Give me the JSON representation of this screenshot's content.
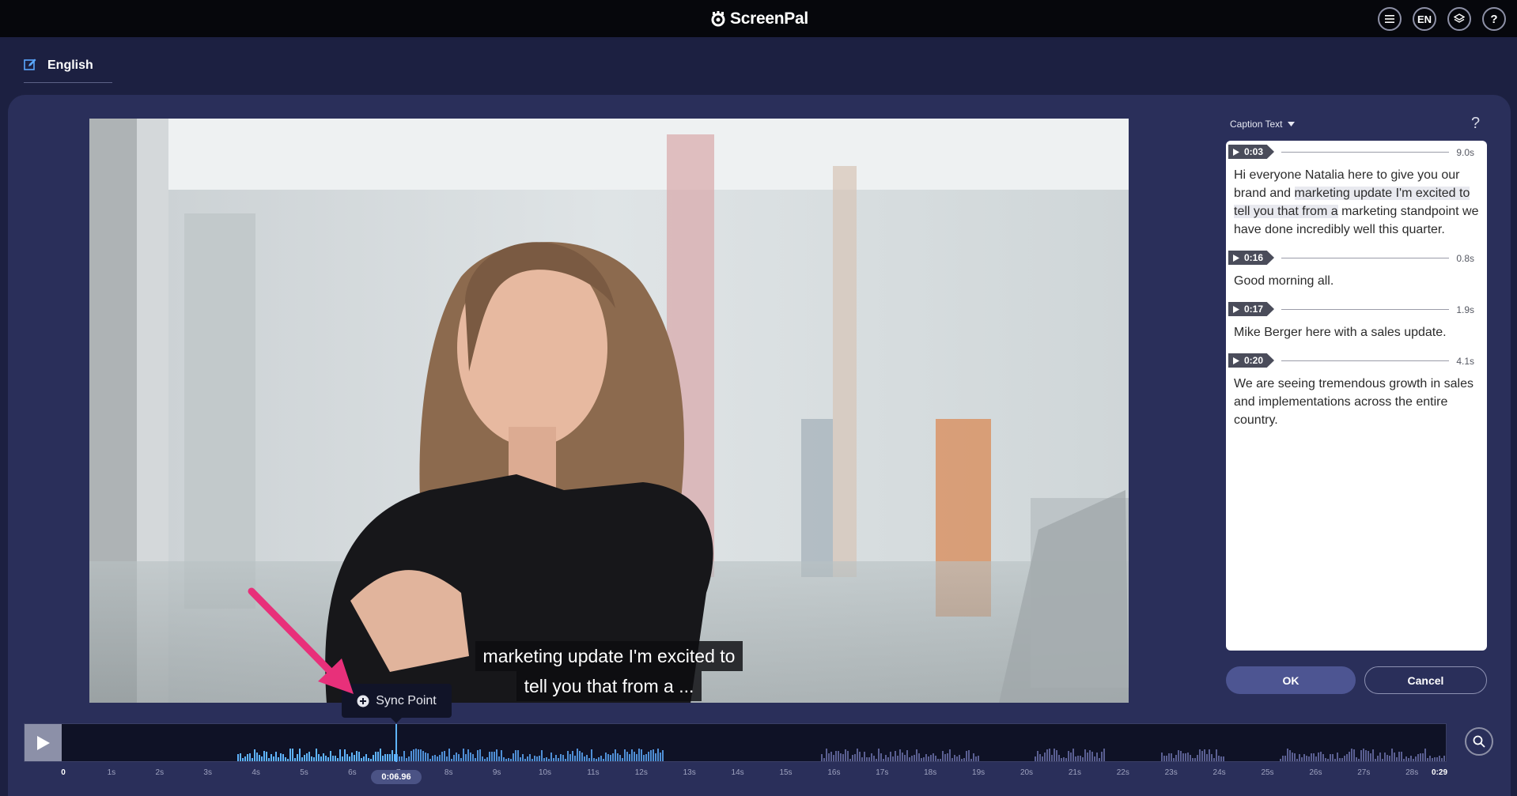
{
  "app": {
    "brand_prefix": "Screen",
    "brand_suffix": "Pal"
  },
  "toolbar": {
    "lang_code": "EN",
    "help": "?"
  },
  "language_tab": {
    "label": "English"
  },
  "video": {
    "caption_line1": "marketing update I'm excited to",
    "caption_line2": "tell you that from a ..."
  },
  "sync_point": {
    "label": "Sync Point"
  },
  "caption_panel": {
    "dropdown_label": "Caption Text",
    "help": "?",
    "segments": [
      {
        "time": "0:03",
        "duration": "9.0s",
        "text_pre": "Hi everyone Natalia here to give you our brand and ",
        "text_hl": "marketing update I'm excited to tell you that from a",
        "text_post": " marketing standpoint we have done incredibly well this quarter."
      },
      {
        "time": "0:16",
        "duration": "0.8s",
        "text": "Good morning all."
      },
      {
        "time": "0:17",
        "duration": "1.9s",
        "text": "Mike Berger here with a sales update."
      },
      {
        "time": "0:20",
        "duration": "4.1s",
        "text": "We are seeing tremendous growth in sales and implementations across the entire country."
      }
    ],
    "ok_label": "OK",
    "cancel_label": "Cancel"
  },
  "timeline": {
    "playhead_time": "0:06.96",
    "tick_labels": [
      "0",
      "1s",
      "2s",
      "3s",
      "4s",
      "5s",
      "6s",
      "7s",
      "8s",
      "9s",
      "10s",
      "11s",
      "12s",
      "13s",
      "14s",
      "15s",
      "16s",
      "17s",
      "18s",
      "19s",
      "20s",
      "21s",
      "22s",
      "23s",
      "24s",
      "25s",
      "26s",
      "27s",
      "28s",
      "0:29"
    ]
  },
  "colors": {
    "background": "#1c2041",
    "panel": "#2a2f5a",
    "accent": "#4d5592",
    "waveform_played": "#5fb4ff",
    "waveform_unplayed": "#5a5f92",
    "annotation_arrow": "#e8307a"
  }
}
